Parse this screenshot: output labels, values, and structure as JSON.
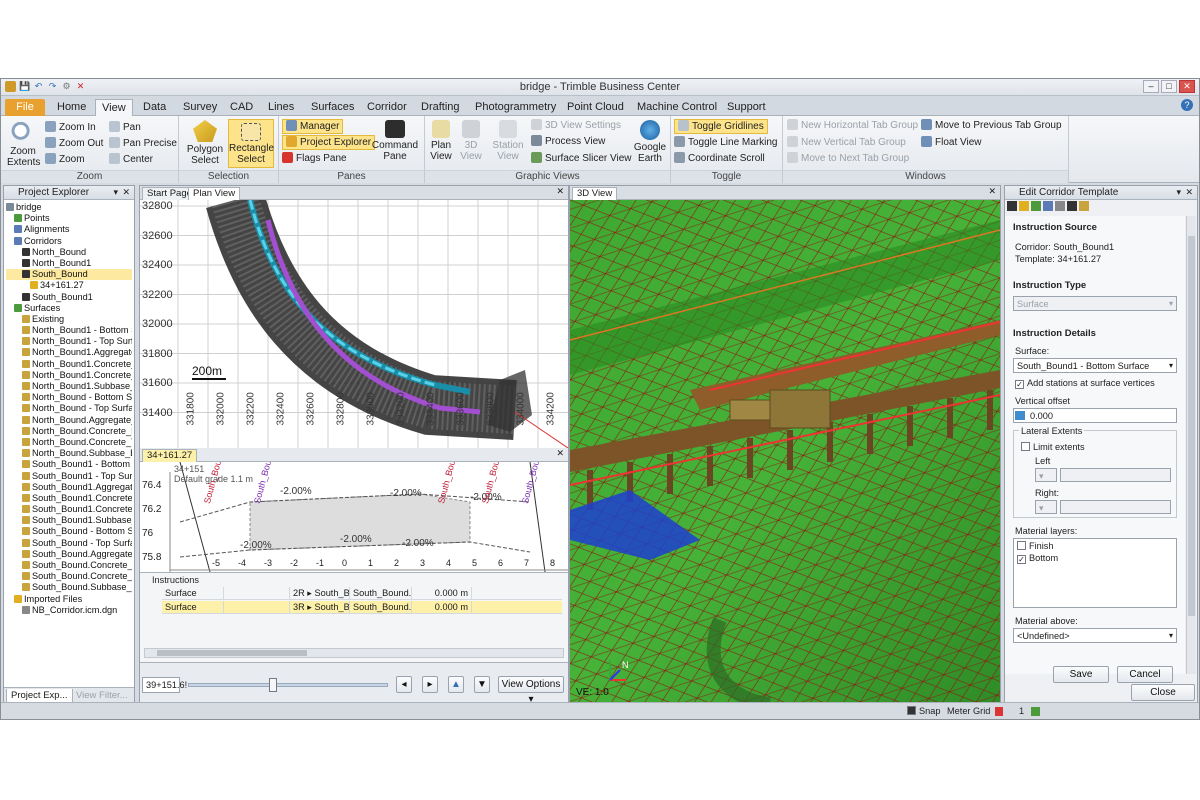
{
  "window": {
    "title": "bridge - Trimble Business Center",
    "min": "–",
    "max": "□",
    "close": "✕"
  },
  "qat": [
    "💾",
    "↶",
    "↷",
    "⚙",
    "✕"
  ],
  "tabs": [
    "File",
    "Home",
    "View",
    "Data",
    "Survey",
    "CAD",
    "Lines",
    "Surfaces",
    "Corridor",
    "Drafting",
    "Photogrammetry",
    "Point Cloud",
    "Machine Control",
    "Support"
  ],
  "active_tab": "View",
  "ribbon": {
    "zoom": {
      "zoom_in": "Zoom In",
      "zoom_out": "Zoom Out",
      "zoom": "Zoom",
      "zoom_extents_1": "Zoom",
      "zoom_extents_2": "Extents",
      "pan": "Pan",
      "pan_precise": "Pan Precise",
      "center": "Center",
      "label": "Zoom"
    },
    "selection": {
      "polygon_1": "Polygon",
      "polygon_2": "Select",
      "rect_1": "Rectangle",
      "rect_2": "Select",
      "label": "Selection"
    },
    "panes": {
      "manager": "Manager",
      "project_explorer": "Project Explorer",
      "flags_pane": "Flags Pane",
      "command_1": "Command",
      "command_2": "Pane",
      "label": "Panes"
    },
    "graphic_views": {
      "plan_1": "Plan",
      "plan_2": "View",
      "v3d_1": "3D",
      "v3d_2": "View",
      "station_1": "Station",
      "station_2": "View",
      "settings": "3D View Settings",
      "process_view": "Process View",
      "slicer": "Surface Slicer View",
      "google_1": "Google",
      "google_2": "Earth",
      "label": "Graphic Views"
    },
    "toggle": {
      "gridlines": "Toggle Gridlines",
      "line_marking": "Toggle Line Marking",
      "coord_scroll": "Coordinate Scroll",
      "label": "Toggle"
    },
    "windows": {
      "new_h": "New Horizontal Tab Group",
      "new_v": "New Vertical Tab Group",
      "move_next": "Move to Next Tab Group",
      "move_prev": "Move to Previous Tab Group",
      "float": "Float View",
      "label": "Windows"
    }
  },
  "project_explorer": {
    "title": "Project Explorer",
    "items": [
      {
        "label": "bridge",
        "indent": 0,
        "color": "#7a8a99"
      },
      {
        "label": "Points",
        "indent": 1,
        "color": "#4c9a3c"
      },
      {
        "label": "Alignments",
        "indent": 1,
        "color": "#5a7bb5"
      },
      {
        "label": "Corridors",
        "indent": 1,
        "color": "#5a7bb5"
      },
      {
        "label": "North_Bound",
        "indent": 2,
        "color": "#333"
      },
      {
        "label": "North_Bound1",
        "indent": 2,
        "color": "#333"
      },
      {
        "label": "South_Bound",
        "indent": 2,
        "color": "#333",
        "sel": true
      },
      {
        "label": "34+161.27",
        "indent": 3,
        "color": "#e0b020"
      },
      {
        "label": "South_Bound1",
        "indent": 2,
        "color": "#333"
      },
      {
        "label": "Surfaces",
        "indent": 1,
        "color": "#4c9a3c"
      },
      {
        "label": "Existing",
        "indent": 2,
        "color": "#c9a33c"
      },
      {
        "label": "North_Bound1 - Bottom S...",
        "indent": 2,
        "color": "#c9a33c"
      },
      {
        "label": "North_Bound1 - Top Surf...",
        "indent": 2,
        "color": "#c9a33c"
      },
      {
        "label": "North_Bound1.Aggregate...",
        "indent": 2,
        "color": "#c9a33c"
      },
      {
        "label": "North_Bound1.Concrete_...",
        "indent": 2,
        "color": "#c9a33c"
      },
      {
        "label": "North_Bound1.Concrete_...",
        "indent": 2,
        "color": "#c9a33c"
      },
      {
        "label": "North_Bound1.Subbase_...",
        "indent": 2,
        "color": "#c9a33c"
      },
      {
        "label": "North_Bound - Bottom Su...",
        "indent": 2,
        "color": "#c9a33c"
      },
      {
        "label": "North_Bound - Top Surfa...",
        "indent": 2,
        "color": "#c9a33c"
      },
      {
        "label": "North_Bound.Aggregate_...",
        "indent": 2,
        "color": "#c9a33c"
      },
      {
        "label": "North_Bound.Concrete_B...",
        "indent": 2,
        "color": "#c9a33c"
      },
      {
        "label": "North_Bound.Concrete_T...",
        "indent": 2,
        "color": "#c9a33c"
      },
      {
        "label": "North_Bound.Subbase_B...",
        "indent": 2,
        "color": "#c9a33c"
      },
      {
        "label": "South_Bound1 - Bottom S...",
        "indent": 2,
        "color": "#c9a33c"
      },
      {
        "label": "South_Bound1 - Top Surf...",
        "indent": 2,
        "color": "#c9a33c"
      },
      {
        "label": "South_Bound1.Aggregate...",
        "indent": 2,
        "color": "#c9a33c"
      },
      {
        "label": "South_Bound1.Concrete_...",
        "indent": 2,
        "color": "#c9a33c"
      },
      {
        "label": "South_Bound1.Concrete_...",
        "indent": 2,
        "color": "#c9a33c"
      },
      {
        "label": "South_Bound1.Subbase_...",
        "indent": 2,
        "color": "#c9a33c"
      },
      {
        "label": "South_Bound - Bottom Su...",
        "indent": 2,
        "color": "#c9a33c"
      },
      {
        "label": "South_Bound - Top Surfa...",
        "indent": 2,
        "color": "#c9a33c"
      },
      {
        "label": "South_Bound.Aggregate_...",
        "indent": 2,
        "color": "#c9a33c"
      },
      {
        "label": "South_Bound.Concrete_T...",
        "indent": 2,
        "color": "#c9a33c"
      },
      {
        "label": "South_Bound.Concrete_T...",
        "indent": 2,
        "color": "#c9a33c"
      },
      {
        "label": "South_Bound.Subbase_B...",
        "indent": 2,
        "color": "#c9a33c"
      },
      {
        "label": "Imported Files",
        "indent": 1,
        "color": "#e0b020"
      },
      {
        "label": "NB_Corridor.icm.dgn",
        "indent": 2,
        "color": "#888"
      }
    ],
    "bottom_tabs": [
      "Project Exp...",
      "View Filter..."
    ]
  },
  "plan_view": {
    "tabs": [
      "Start Page",
      "Plan View"
    ],
    "y_ticks": [
      "32800",
      "32600",
      "32400",
      "32200",
      "32000",
      "31800",
      "31600",
      "31400"
    ],
    "x_ticks": [
      "331800",
      "332000",
      "332200",
      "332400",
      "332600",
      "332800",
      "333000",
      "333200",
      "333400",
      "333600",
      "333800",
      "334000",
      "334200"
    ],
    "scale": "200m"
  },
  "profile_view": {
    "tab": "34+161.27",
    "y_ticks": [
      "76.4",
      "76.2",
      "76",
      "75.8"
    ],
    "x_ticks": [
      "-5",
      "-4",
      "-3",
      "-2",
      "-1",
      "0",
      "1",
      "2",
      "3",
      "4",
      "5",
      "6",
      "7",
      "8"
    ],
    "grades": [
      "-2.00%",
      "-2.00%",
      "-2.00%",
      "-2.00%",
      "-2.00%",
      "-2.00%"
    ],
    "labels": [
      "South_Bound1:Lft",
      "South_Bound1 - Bott",
      "South_Bound1:Rt",
      "South_Bound1.Rt",
      "South_Bound1 - Bo"
    ],
    "note_1": "34+151",
    "note_2": "Default grade 1.1 m"
  },
  "instructions": {
    "title": "Instructions",
    "rows": [
      {
        "type": "Surface",
        "col2": "",
        "col3": "2R ▸ South_B...",
        "col4": "South_Bound...",
        "col5": "0.000 m"
      },
      {
        "type": "Surface",
        "col2": "",
        "col3": "3R ▸ South_B...",
        "col4": "South_Bound...",
        "col5": "0.000 m",
        "sel": true
      }
    ]
  },
  "station_bar": {
    "station": "39+151.6!",
    "view_options": "View Options ▾"
  },
  "view3d": {
    "tab": "3D View",
    "axis_label": "VE: 1.0"
  },
  "edit_template": {
    "title": "Edit Corridor Template",
    "source_head": "Instruction Source",
    "corridor": "Corridor: South_Bound1",
    "template": "Template: 34+161.27",
    "type_head": "Instruction Type",
    "type_value": "Surface",
    "details_head": "Instruction Details",
    "surface_label": "Surface:",
    "surface_value": "South_Bound1 - Bottom Surface",
    "add_stations": "Add stations at surface vertices",
    "vertical_offset_label": "Vertical offset",
    "vertical_offset_value": "0.000",
    "lateral_extents": "Lateral Extents",
    "limit_extents": "Limit extents",
    "left": "Left",
    "right": "Right:",
    "material_layers": "Material layers:",
    "layers": [
      "Finish",
      "Bottom"
    ],
    "material_above": "Material above:",
    "material_above_value": "<Undefined>",
    "save": "Save",
    "cancel": "Cancel",
    "close": "Close"
  },
  "status": {
    "snap": "Snap",
    "meter": "Meter",
    "grid": "Grid",
    "page": "1"
  }
}
